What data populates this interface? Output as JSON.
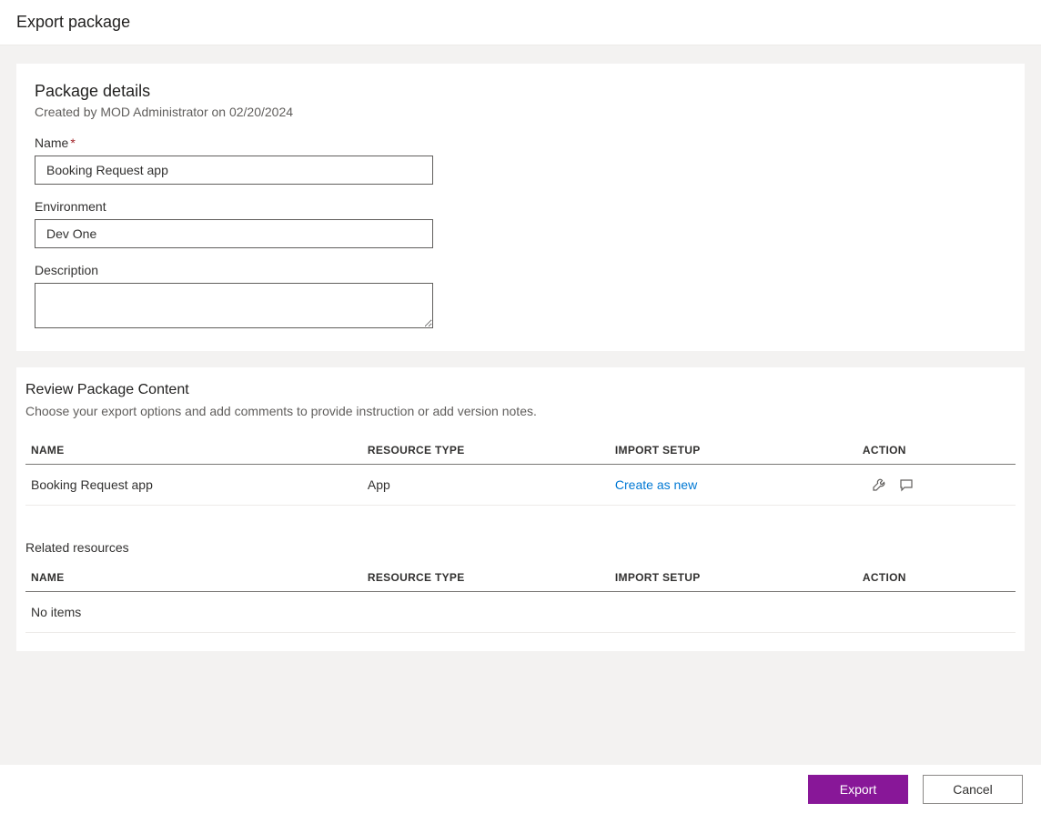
{
  "header": {
    "title": "Export package"
  },
  "packageDetails": {
    "title": "Package details",
    "createdBy": "Created by MOD Administrator on 02/20/2024",
    "nameLabel": "Name",
    "nameValue": "Booking Request app",
    "envLabel": "Environment",
    "envValue": "Dev One",
    "descLabel": "Description",
    "descValue": ""
  },
  "review": {
    "title": "Review Package Content",
    "subtitle": "Choose your export options and add comments to provide instruction or add version notes.",
    "columns": {
      "name": "NAME",
      "resourceType": "RESOURCE TYPE",
      "importSetup": "IMPORT SETUP",
      "action": "ACTION"
    },
    "rows": [
      {
        "name": "Booking Request app",
        "resourceType": "App",
        "importSetup": "Create as new"
      }
    ],
    "relatedTitle": "Related resources",
    "noItems": "No items"
  },
  "footer": {
    "export": "Export",
    "cancel": "Cancel"
  }
}
